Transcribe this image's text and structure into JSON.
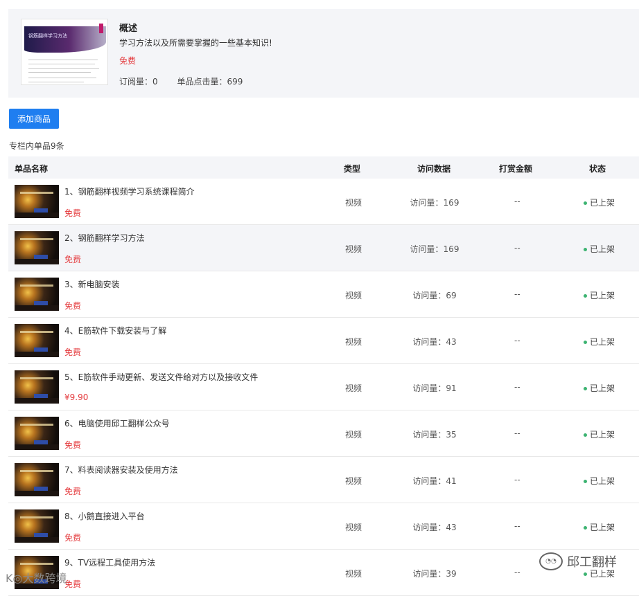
{
  "summary": {
    "cover_title": "钢筋翻样学习方法",
    "title": "概述",
    "description": "学习方法以及所需要掌握的一些基本知识!",
    "price": "免费",
    "subscribers": "订阅量：0",
    "clicks": "单品点击量：699"
  },
  "toolbar": {
    "add_label": "添加商品"
  },
  "list_count": "专栏内单品9条",
  "columns": {
    "name": "单品名称",
    "type": "类型",
    "visits": "访问数据",
    "reward": "打赏金额",
    "status": "状态"
  },
  "rows": [
    {
      "title": "1、钢筋翻样视频学习系统课程简介",
      "price": "免费",
      "type": "视频",
      "visits": "访问量：169",
      "reward": "--",
      "status": "已上架"
    },
    {
      "title": "2、钢筋翻样学习方法",
      "price": "免费",
      "type": "视频",
      "visits": "访问量：169",
      "reward": "--",
      "status": "已上架"
    },
    {
      "title": "3、新电脑安装",
      "price": "免费",
      "type": "视频",
      "visits": "访问量：69",
      "reward": "--",
      "status": "已上架"
    },
    {
      "title": "4、E筋软件下载安装与了解",
      "price": "免费",
      "type": "视频",
      "visits": "访问量：43",
      "reward": "--",
      "status": "已上架"
    },
    {
      "title": "5、E筋软件手动更新、发送文件给对方以及接收文件",
      "price": "¥9.90",
      "type": "视频",
      "visits": "访问量：91",
      "reward": "--",
      "status": "已上架"
    },
    {
      "title": "6、电脑使用邱工翻样公众号",
      "price": "免费",
      "type": "视频",
      "visits": "访问量：35",
      "reward": "--",
      "status": "已上架"
    },
    {
      "title": "7、料表阅读器安装及使用方法",
      "price": "免费",
      "type": "视频",
      "visits": "访问量：41",
      "reward": "--",
      "status": "已上架"
    },
    {
      "title": "8、小鹅直接进入平台",
      "price": "免费",
      "type": "视频",
      "visits": "访问量：43",
      "reward": "--",
      "status": "已上架"
    },
    {
      "title": "9、TV远程工具使用方法",
      "price": "免费",
      "type": "视频",
      "visits": "访问量：39",
      "reward": "--",
      "status": "已上架"
    }
  ],
  "watermark": {
    "text": "邱工翻样",
    "left_text": "K◎大数跨境"
  },
  "colors": {
    "accent": "#1f7ef0",
    "price": "#e4393c",
    "status_dot": "#3cb371",
    "panel": "#f4f5f8"
  }
}
